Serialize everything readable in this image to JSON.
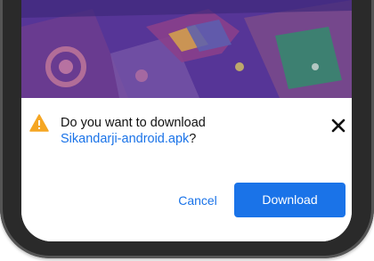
{
  "dialog": {
    "message_prefix": "Do you want to download",
    "file_name": "Sikandarji-android.apk",
    "message_suffix": "?",
    "cancel_label": "Cancel",
    "download_label": "Download",
    "close_icon": "close-icon",
    "warning_icon": "warning-icon"
  },
  "colors": {
    "accent": "#1a73e8",
    "warning": "#f5a623",
    "banner": "#5a3aa0"
  }
}
